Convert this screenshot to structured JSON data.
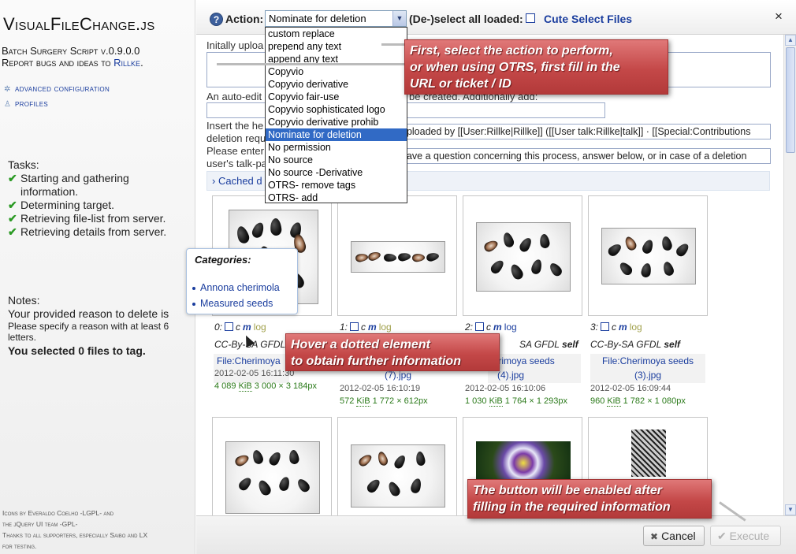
{
  "sidebar": {
    "title": "VisualFileChange.js",
    "subtitle": "Batch Surgery Script v.0.9.0.0",
    "report_prefix": "Report bugs and ideas to",
    "report_link": "Rillke",
    "report_suffix": ".",
    "nav": [
      {
        "label": "advanced configuration",
        "icon": "wrench-icon"
      },
      {
        "label": "profiles",
        "icon": "user-icon"
      }
    ],
    "tasks_title": "Tasks:",
    "tasks": [
      {
        "line1": "Starting and gathering",
        "line2": "information."
      },
      {
        "line1": "Determining target.",
        "line2": ""
      },
      {
        "line1": "Retrieving file-list from server.",
        "line2": ""
      },
      {
        "line1": "Retrieving details from server.",
        "line2": ""
      }
    ],
    "notes_title": "Notes:",
    "note_reason": "Your provided reason to delete is",
    "note_specify1": "Please specify a reason with at least 6",
    "note_specify2": "letters.",
    "note_selected": "You selected 0 files to tag.",
    "credits": [
      "Icons by Everaldo Coelho -LGPL- and",
      "the jQuery UI team -GPL-",
      "Thanks to all supporters, especially Saibo and LX",
      "for testing."
    ]
  },
  "dialog": {
    "action_label": "Action:",
    "action_value": "Nominate for deletion",
    "deselect_label": "(De-)select all loaded:",
    "cute_select": "Cute Select Files",
    "close": "×",
    "form": {
      "reason_label": "Initally uploa",
      "autoedit_label_a": "An auto-edit",
      "autoedit_label_b": "be created. Additionally add:",
      "insert_label": "Insert the he",
      "deletion_label": "deletion requ",
      "insert_value": "uploaded by [[User:Rillke|Rillke]] ([[User talk:Rillke|talk]] · [[Special:Contributions",
      "please_label": "Please enter",
      "talkpage_label": "user's talk-pa",
      "please_value": "have a question concerning this process, answer below, or in case of a deletion",
      "cached_label": "Cached d"
    },
    "cancel": "Cancel",
    "execute": "Execute"
  },
  "dropdown": {
    "items": [
      "custom replace",
      "prepend any text",
      "append any text",
      "Copyvio",
      "Copyvio derivative",
      "Copyvio fair-use",
      "Copyvio sophisticated logo",
      "Copyvio derivative prohib",
      "Nominate for deletion",
      "No permission",
      "No source",
      "No source -Derivative",
      "OTRS- remove tags",
      "OTRS- add"
    ],
    "selected_index": 8
  },
  "files": [
    {
      "index": "0:",
      "license": "CC-By-SA",
      "license2": "GFDL",
      "license3": "",
      "filename_1": "File:Cherimoya",
      "filename_2": "",
      "date": "2012-02-05 16:11:30",
      "size": "4 089",
      "unit": "KiB",
      "dims": "3 000 × 3 184px"
    },
    {
      "index": "1:",
      "license": "",
      "license2": "",
      "license3": "",
      "filename_1": "",
      "filename_2": "",
      "date": "2012-02-05 16:10:19",
      "size": "572",
      "unit": "KiB",
      "dims": "1 772 × 612px"
    },
    {
      "index": "2:",
      "license": "SA",
      "license2": "GFDL",
      "license3": "self",
      "filename_1": "herimoya seeds",
      "filename_2": "(4).jpg",
      "date": "2012-02-05 16:10:06",
      "size": "1 030",
      "unit": "KiB",
      "dims": "1 764 × 1 293px"
    },
    {
      "index": "3:",
      "license": "CC-By-SA",
      "license2": "GFDL",
      "license3": "self",
      "filename_1": "File:Cherimoya seeds",
      "filename_2": "(3).jpg",
      "date": "2012-02-05 16:09:44",
      "size": "960",
      "unit": "KiB",
      "dims": "1 782 × 1 080px"
    }
  ],
  "file_links": {
    "c": "c",
    "m": "m",
    "log": "log"
  },
  "file1_filename_2": "(7).jpg",
  "tooltip": {
    "title": "Categories:",
    "items": [
      "Annona cherimola",
      "Measured seeds"
    ]
  },
  "callouts": {
    "action_1": "First, select the action to perform,",
    "action_2": "or when using OTRS, first fill in the",
    "action_3": "URL or ticket / ID",
    "hover_1": "Hover a dotted element",
    "hover_2": "to obtain further information",
    "button_1": "The button will be enabled after",
    "button_2": "filling in the required information"
  },
  "colors": {
    "link": "#1a3d9e",
    "selection": "#316ac5",
    "callout": "#c44848",
    "size_green": "#2b7a1a",
    "check_green": "#2b9a24"
  }
}
